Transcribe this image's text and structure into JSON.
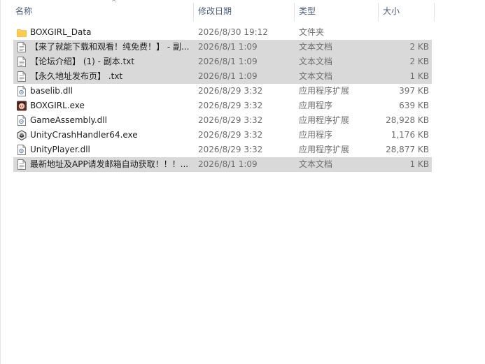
{
  "columns": {
    "name": "名称",
    "date": "修改日期",
    "type": "类型",
    "size": "大小"
  },
  "files": [
    {
      "name": "BOXGIRL_Data",
      "date": "2026/8/30 19:12",
      "type": "文件夹",
      "size": "",
      "icon": "folder-icon",
      "selected": false
    },
    {
      "name": "【来了就能下载和观看！纯免费！】 - 副...",
      "date": "2026/8/1 1:09",
      "type": "文本文档",
      "size": "2 KB",
      "icon": "text-file-icon",
      "selected": true
    },
    {
      "name": "【论坛介绍】 (1) - 副本.txt",
      "date": "2026/8/1 1:09",
      "type": "文本文档",
      "size": "2 KB",
      "icon": "text-file-icon",
      "selected": true
    },
    {
      "name": "【永久地址发布页】 .txt",
      "date": "2026/8/1 1:09",
      "type": "文本文档",
      "size": "1 KB",
      "icon": "text-file-icon",
      "selected": true
    },
    {
      "name": "baselib.dll",
      "date": "2026/8/29 3:32",
      "type": "应用程序扩展",
      "size": "397 KB",
      "icon": "dll-file-icon",
      "selected": false
    },
    {
      "name": "BOXGIRL.exe",
      "date": "2026/8/29 3:32",
      "type": "应用程序",
      "size": "639 KB",
      "icon": "boxgirl-app-icon",
      "selected": false
    },
    {
      "name": "GameAssembly.dll",
      "date": "2026/8/29 3:32",
      "type": "应用程序扩展",
      "size": "28,928 KB",
      "icon": "dll-file-icon",
      "selected": false
    },
    {
      "name": "UnityCrashHandler64.exe",
      "date": "2026/8/29 3:32",
      "type": "应用程序",
      "size": "1,176 KB",
      "icon": "unity-app-icon",
      "selected": false
    },
    {
      "name": "UnityPlayer.dll",
      "date": "2026/8/29 3:32",
      "type": "应用程序扩展",
      "size": "28,877 KB",
      "icon": "dll-file-icon",
      "selected": false
    },
    {
      "name": "最新地址及APP请发邮箱自动获取！！！...",
      "date": "2026/8/1 1:09",
      "type": "文本文档",
      "size": "1 KB",
      "icon": "text-file-icon",
      "selected": true
    }
  ],
  "colors": {
    "selection": "#d9d9d9",
    "header_text": "#4c607a",
    "folder": "#ffd15e"
  }
}
